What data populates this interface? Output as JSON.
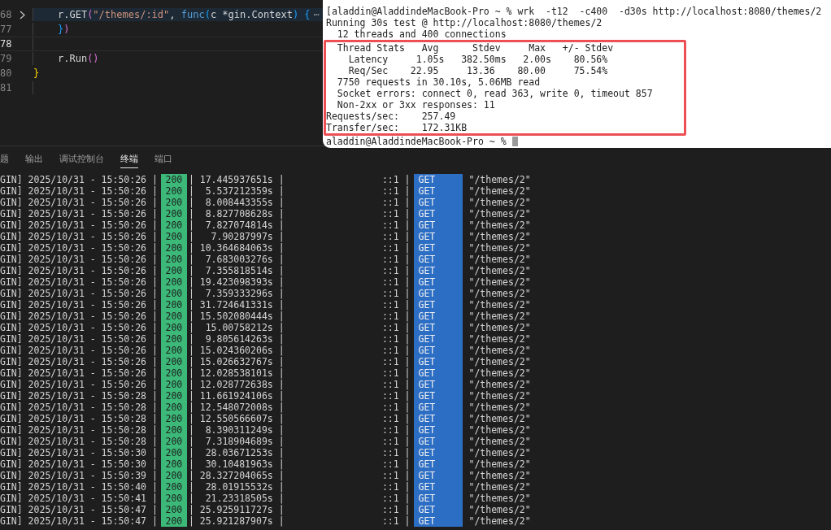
{
  "editor": {
    "lines": [
      {
        "number": "68",
        "current": false,
        "folded": true,
        "outer": false,
        "tokens": [
          {
            "kind": "plain",
            "text": "r.GET"
          },
          {
            "kind": "bracket2",
            "text": "("
          },
          {
            "kind": "string",
            "text": "\"/themes/:id\""
          },
          {
            "kind": "plain",
            "text": ", "
          },
          {
            "kind": "keyword",
            "text": "func"
          },
          {
            "kind": "bracket3",
            "text": "("
          },
          {
            "kind": "plain",
            "text": "c *gin.Context"
          },
          {
            "kind": "bracket3",
            "text": ")"
          },
          {
            "kind": "bracket3",
            "text": "{"
          },
          {
            "kind": "fold",
            "text": "⋯"
          }
        ]
      },
      {
        "number": "77",
        "current": false,
        "folded": false,
        "outer": false,
        "tokens": [
          {
            "kind": "bracket3",
            "text": "}"
          },
          {
            "kind": "bracket2",
            "text": ")"
          }
        ]
      },
      {
        "number": "78",
        "current": true,
        "folded": false,
        "outer": false
      },
      {
        "number": "79",
        "current": false,
        "folded": false,
        "outer": false,
        "tokens": [
          {
            "kind": "plain",
            "text": "r.Run"
          },
          {
            "kind": "bracket2",
            "text": "()"
          }
        ]
      },
      {
        "number": "80",
        "current": false,
        "folded": false,
        "outer": true,
        "tokens": [
          {
            "kind": "bracket1",
            "text": "}"
          }
        ]
      },
      {
        "number": "81",
        "current": false,
        "folded": false,
        "outer": false
      }
    ]
  },
  "terminal": {
    "lines": [
      "[aladdin@AladdindeMacBook-Pro ~ % wrk  -t12  -c400  -d30s http://localhost:8080/themes/2",
      "Running 30s test @ http://localhost:8080/themes/2",
      "  12 threads and 400 connections"
    ],
    "highlighted": [
      "  Thread Stats   Avg      Stdev     Max   +/- Stdev",
      "    Latency     1.05s   382.50ms   2.00s    80.56%",
      "    Req/Sec    22.95     13.36    80.00     75.54%",
      "  7750 requests in 30.10s, 5.06MB read",
      "  Socket errors: connect 0, read 363, write 0, timeout 857",
      "  Non-2xx or 3xx responses: 11",
      "Requests/sec:    257.49",
      "Transfer/sec:    172.31KB"
    ],
    "prompt": "aladdin@AladdindeMacBook-Pro ~ %"
  },
  "panel_tabs": [
    {
      "label": "题",
      "selected": false
    },
    {
      "label": "输出",
      "selected": false
    },
    {
      "label": "调试控制台",
      "selected": false
    },
    {
      "label": "终端",
      "selected": true
    },
    {
      "label": "端口",
      "selected": false
    }
  ],
  "log_rows": [
    {
      "time": "GIN] 2025/10/31 - 15:50:26 |",
      "status": "200",
      "latency": "| 17.445937651s |",
      "ip": "::1 |",
      "method": "GET",
      "path": "\"/themes/2\""
    },
    {
      "time": "GIN] 2025/10/31 - 15:50:26 |",
      "status": "200",
      "latency": "|  5.537212359s |",
      "ip": "::1 |",
      "method": "GET",
      "path": "\"/themes/2\""
    },
    {
      "time": "GIN] 2025/10/31 - 15:50:26 |",
      "status": "200",
      "latency": "|  8.008443355s |",
      "ip": "::1 |",
      "method": "GET",
      "path": "\"/themes/2\""
    },
    {
      "time": "GIN] 2025/10/31 - 15:50:26 |",
      "status": "200",
      "latency": "|  8.827708628s |",
      "ip": "::1 |",
      "method": "GET",
      "path": "\"/themes/2\""
    },
    {
      "time": "GIN] 2025/10/31 - 15:50:26 |",
      "status": "200",
      "latency": "|  7.827074814s |",
      "ip": "::1 |",
      "method": "GET",
      "path": "\"/themes/2\""
    },
    {
      "time": "GIN] 2025/10/31 - 15:50:26 |",
      "status": "200",
      "latency": "|   7.90287997s |",
      "ip": "::1 |",
      "method": "GET",
      "path": "\"/themes/2\""
    },
    {
      "time": "GIN] 2025/10/31 - 15:50:26 |",
      "status": "200",
      "latency": "| 10.364684063s |",
      "ip": "::1 |",
      "method": "GET",
      "path": "\"/themes/2\""
    },
    {
      "time": "GIN] 2025/10/31 - 15:50:26 |",
      "status": "200",
      "latency": "|  7.683003276s |",
      "ip": "::1 |",
      "method": "GET",
      "path": "\"/themes/2\""
    },
    {
      "time": "GIN] 2025/10/31 - 15:50:26 |",
      "status": "200",
      "latency": "|  7.355818514s |",
      "ip": "::1 |",
      "method": "GET",
      "path": "\"/themes/2\""
    },
    {
      "time": "GIN] 2025/10/31 - 15:50:26 |",
      "status": "200",
      "latency": "| 19.423098393s |",
      "ip": "::1 |",
      "method": "GET",
      "path": "\"/themes/2\""
    },
    {
      "time": "GIN] 2025/10/31 - 15:50:26 |",
      "status": "200",
      "latency": "|  7.359333296s |",
      "ip": "::1 |",
      "method": "GET",
      "path": "\"/themes/2\""
    },
    {
      "time": "GIN] 2025/10/31 - 15:50:26 |",
      "status": "200",
      "latency": "| 31.724641331s |",
      "ip": "::1 |",
      "method": "GET",
      "path": "\"/themes/2\""
    },
    {
      "time": "GIN] 2025/10/31 - 15:50:26 |",
      "status": "200",
      "latency": "| 15.502080444s |",
      "ip": "::1 |",
      "method": "GET",
      "path": "\"/themes/2\""
    },
    {
      "time": "GIN] 2025/10/31 - 15:50:26 |",
      "status": "200",
      "latency": "|  15.00758212s |",
      "ip": "::1 |",
      "method": "GET",
      "path": "\"/themes/2\""
    },
    {
      "time": "GIN] 2025/10/31 - 15:50:26 |",
      "status": "200",
      "latency": "|  9.805614263s |",
      "ip": "::1 |",
      "method": "GET",
      "path": "\"/themes/2\""
    },
    {
      "time": "GIN] 2025/10/31 - 15:50:26 |",
      "status": "200",
      "latency": "| 15.024360206s |",
      "ip": "::1 |",
      "method": "GET",
      "path": "\"/themes/2\""
    },
    {
      "time": "GIN] 2025/10/31 - 15:50:26 |",
      "status": "200",
      "latency": "| 15.026632767s |",
      "ip": "::1 |",
      "method": "GET",
      "path": "\"/themes/2\""
    },
    {
      "time": "GIN] 2025/10/31 - 15:50:26 |",
      "status": "200",
      "latency": "| 12.028538101s |",
      "ip": "::1 |",
      "method": "GET",
      "path": "\"/themes/2\""
    },
    {
      "time": "GIN] 2025/10/31 - 15:50:26 |",
      "status": "200",
      "latency": "| 12.028772638s |",
      "ip": "::1 |",
      "method": "GET",
      "path": "\"/themes/2\""
    },
    {
      "time": "GIN] 2025/10/31 - 15:50:28 |",
      "status": "200",
      "latency": "| 11.661924106s |",
      "ip": "::1 |",
      "method": "GET",
      "path": "\"/themes/2\""
    },
    {
      "time": "GIN] 2025/10/31 - 15:50:28 |",
      "status": "200",
      "latency": "| 12.548072008s |",
      "ip": "::1 |",
      "method": "GET",
      "path": "\"/themes/2\""
    },
    {
      "time": "GIN] 2025/10/31 - 15:50:28 |",
      "status": "200",
      "latency": "| 12.550566607s |",
      "ip": "::1 |",
      "method": "GET",
      "path": "\"/themes/2\""
    },
    {
      "time": "GIN] 2025/10/31 - 15:50:28 |",
      "status": "200",
      "latency": "|  8.390311249s |",
      "ip": "::1 |",
      "method": "GET",
      "path": "\"/themes/2\""
    },
    {
      "time": "GIN] 2025/10/31 - 15:50:28 |",
      "status": "200",
      "latency": "|  7.318904689s |",
      "ip": "::1 |",
      "method": "GET",
      "path": "\"/themes/2\""
    },
    {
      "time": "GIN] 2025/10/31 - 15:50:30 |",
      "status": "200",
      "latency": "|  28.03671253s |",
      "ip": "::1 |",
      "method": "GET",
      "path": "\"/themes/2\""
    },
    {
      "time": "GIN] 2025/10/31 - 15:50:30 |",
      "status": "200",
      "latency": "|  30.10481963s |",
      "ip": "::1 |",
      "method": "GET",
      "path": "\"/themes/2\""
    },
    {
      "time": "GIN] 2025/10/31 - 15:50:39 |",
      "status": "200",
      "latency": "| 28.327204065s |",
      "ip": "::1 |",
      "method": "GET",
      "path": "\"/themes/2\""
    },
    {
      "time": "GIN] 2025/10/31 - 15:50:40 |",
      "status": "200",
      "latency": "|  28.01915532s |",
      "ip": "::1 |",
      "method": "GET",
      "path": "\"/themes/2\""
    },
    {
      "time": "GIN] 2025/10/31 - 15:50:41 |",
      "status": "200",
      "latency": "|  21.23318505s |",
      "ip": "::1 |",
      "method": "GET",
      "path": "\"/themes/2\""
    },
    {
      "time": "GIN] 2025/10/31 - 15:50:47 |",
      "status": "200",
      "latency": "| 25.925911727s |",
      "ip": "::1 |",
      "method": "GET",
      "path": "\"/themes/2\""
    },
    {
      "time": "GIN] 2025/10/31 - 15:50:47 |",
      "status": "200",
      "latency": "| 25.921287907s |",
      "ip": "::1 |",
      "method": "GET",
      "path": "\"/themes/2\""
    }
  ]
}
